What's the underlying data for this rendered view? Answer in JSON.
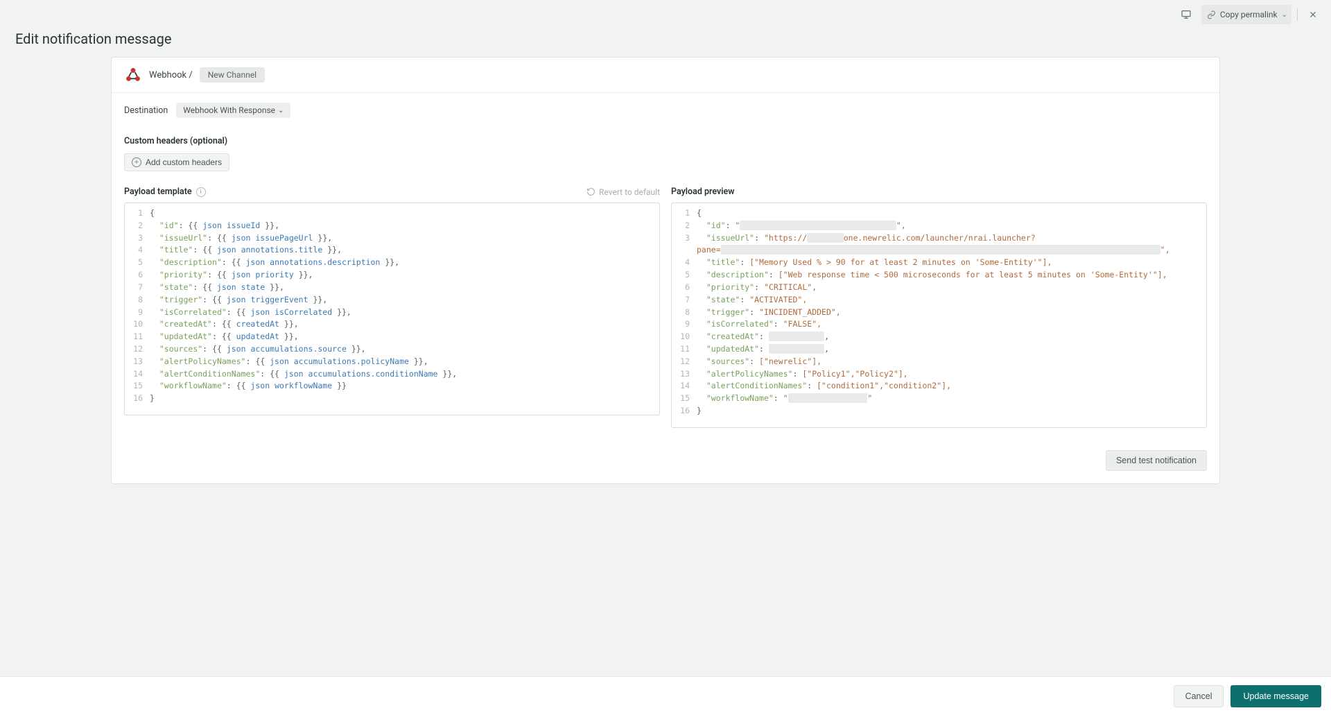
{
  "topbar": {
    "copy_permalink": "Copy permalink"
  },
  "page": {
    "title": "Edit notification message"
  },
  "header": {
    "breadcrumb": "Webhook /",
    "channel_chip": "New Channel"
  },
  "destination": {
    "label": "Destination",
    "value": "Webhook With Response"
  },
  "custom_headers": {
    "label": "Custom headers (optional)",
    "button": "Add custom headers"
  },
  "template": {
    "title": "Payload template",
    "revert": "Revert to default",
    "lines": [
      {
        "n": 1,
        "segs": [
          [
            "{",
            "pun"
          ]
        ]
      },
      {
        "n": 2,
        "segs": [
          [
            "  ",
            ""
          ],
          [
            "\"id\"",
            "prop"
          ],
          [
            ": {{ ",
            "pun"
          ],
          [
            "json",
            "kw"
          ],
          [
            " ",
            "pun"
          ],
          [
            "issueId",
            "kw"
          ],
          [
            " }},",
            "pun"
          ]
        ]
      },
      {
        "n": 3,
        "segs": [
          [
            "  ",
            ""
          ],
          [
            "\"issueUrl\"",
            "prop"
          ],
          [
            ": {{ ",
            "pun"
          ],
          [
            "json",
            "kw"
          ],
          [
            " ",
            "pun"
          ],
          [
            "issuePageUrl",
            "kw"
          ],
          [
            " }},",
            "pun"
          ]
        ]
      },
      {
        "n": 4,
        "segs": [
          [
            "  ",
            ""
          ],
          [
            "\"title\"",
            "prop"
          ],
          [
            ": {{ ",
            "pun"
          ],
          [
            "json",
            "kw"
          ],
          [
            " ",
            "pun"
          ],
          [
            "annotations.title",
            "kw"
          ],
          [
            " }},",
            "pun"
          ]
        ]
      },
      {
        "n": 5,
        "segs": [
          [
            "  ",
            ""
          ],
          [
            "\"description\"",
            "prop"
          ],
          [
            ": {{ ",
            "pun"
          ],
          [
            "json",
            "kw"
          ],
          [
            " ",
            "pun"
          ],
          [
            "annotations.description",
            "kw"
          ],
          [
            " }},",
            "pun"
          ]
        ]
      },
      {
        "n": 6,
        "segs": [
          [
            "  ",
            ""
          ],
          [
            "\"priority\"",
            "prop"
          ],
          [
            ": {{ ",
            "pun"
          ],
          [
            "json",
            "kw"
          ],
          [
            " ",
            "pun"
          ],
          [
            "priority",
            "kw"
          ],
          [
            " }},",
            "pun"
          ]
        ]
      },
      {
        "n": 7,
        "segs": [
          [
            "  ",
            ""
          ],
          [
            "\"state\"",
            "prop"
          ],
          [
            ": {{ ",
            "pun"
          ],
          [
            "json",
            "kw"
          ],
          [
            " ",
            "pun"
          ],
          [
            "state",
            "kw"
          ],
          [
            " }},",
            "pun"
          ]
        ]
      },
      {
        "n": 8,
        "segs": [
          [
            "  ",
            ""
          ],
          [
            "\"trigger\"",
            "prop"
          ],
          [
            ": {{ ",
            "pun"
          ],
          [
            "json",
            "kw"
          ],
          [
            " ",
            "pun"
          ],
          [
            "triggerEvent",
            "kw"
          ],
          [
            " }},",
            "pun"
          ]
        ]
      },
      {
        "n": 9,
        "segs": [
          [
            "  ",
            ""
          ],
          [
            "\"isCorrelated\"",
            "prop"
          ],
          [
            ": {{ ",
            "pun"
          ],
          [
            "json",
            "kw"
          ],
          [
            " ",
            "pun"
          ],
          [
            "isCorrelated",
            "kw"
          ],
          [
            " }},",
            "pun"
          ]
        ]
      },
      {
        "n": 10,
        "segs": [
          [
            "  ",
            ""
          ],
          [
            "\"createdAt\"",
            "prop"
          ],
          [
            ": {{ ",
            "pun"
          ],
          [
            "createdAt",
            "kw"
          ],
          [
            " }},",
            "pun"
          ]
        ]
      },
      {
        "n": 11,
        "segs": [
          [
            "  ",
            ""
          ],
          [
            "\"updatedAt\"",
            "prop"
          ],
          [
            ": {{ ",
            "pun"
          ],
          [
            "updatedAt",
            "kw"
          ],
          [
            " }},",
            "pun"
          ]
        ]
      },
      {
        "n": 12,
        "segs": [
          [
            "  ",
            ""
          ],
          [
            "\"sources\"",
            "prop"
          ],
          [
            ": {{ ",
            "pun"
          ],
          [
            "json",
            "kw"
          ],
          [
            " ",
            "pun"
          ],
          [
            "accumulations.source",
            "kw"
          ],
          [
            " }},",
            "pun"
          ]
        ]
      },
      {
        "n": 13,
        "segs": [
          [
            "  ",
            ""
          ],
          [
            "\"alertPolicyNames\"",
            "prop"
          ],
          [
            ": {{ ",
            "pun"
          ],
          [
            "json",
            "kw"
          ],
          [
            " ",
            "pun"
          ],
          [
            "accumulations.policyName",
            "kw"
          ],
          [
            " }},",
            "pun"
          ]
        ]
      },
      {
        "n": 14,
        "segs": [
          [
            "  ",
            ""
          ],
          [
            "\"alertConditionNames\"",
            "prop"
          ],
          [
            ": {{ ",
            "pun"
          ],
          [
            "json",
            "kw"
          ],
          [
            " ",
            "pun"
          ],
          [
            "accumulations.conditionName",
            "kw"
          ],
          [
            " }},",
            "pun"
          ]
        ]
      },
      {
        "n": 15,
        "segs": [
          [
            "  ",
            ""
          ],
          [
            "\"workflowName\"",
            "prop"
          ],
          [
            ": {{ ",
            "pun"
          ],
          [
            "json",
            "kw"
          ],
          [
            " ",
            "pun"
          ],
          [
            "workflowName",
            "kw"
          ],
          [
            " }}",
            "pun"
          ]
        ]
      },
      {
        "n": 16,
        "segs": [
          [
            "}",
            "pun"
          ]
        ]
      }
    ]
  },
  "preview": {
    "title": "Payload preview",
    "lines": [
      {
        "n": 1,
        "segs": [
          [
            "{",
            "pun"
          ]
        ]
      },
      {
        "n": 2,
        "segs": [
          [
            "  ",
            ""
          ],
          [
            "\"id\"",
            "prop"
          ],
          [
            ": ",
            "pun"
          ],
          [
            "\"",
            "str"
          ],
          [
            "████████████████████████████████",
            "redact"
          ],
          [
            "\",",
            "str"
          ]
        ]
      },
      {
        "n": 3,
        "segs": [
          [
            "  ",
            ""
          ],
          [
            "\"issueUrl\"",
            "prop"
          ],
          [
            ": ",
            "pun"
          ],
          [
            "\"https://",
            "str"
          ],
          [
            "███████",
            "redact"
          ],
          [
            "one.newrelic.com/launcher/nrai.launcher?pane=",
            "str"
          ],
          [
            "███████████████████████████████████████████████████████████████████████████████████████████",
            "redact"
          ],
          [
            "\",",
            "str"
          ]
        ]
      },
      {
        "n": 4,
        "segs": [
          [
            "  ",
            ""
          ],
          [
            "\"title\"",
            "prop"
          ],
          [
            ": ",
            "pun"
          ],
          [
            "[\"Memory Used % > 90 for at least 2 minutes on 'Some-Entity'\"],",
            "str"
          ]
        ]
      },
      {
        "n": 5,
        "segs": [
          [
            "  ",
            ""
          ],
          [
            "\"description\"",
            "prop"
          ],
          [
            ": ",
            "pun"
          ],
          [
            "[\"Web response time < 500 microseconds for at least 5 minutes on 'Some-Entity'\"],",
            "str"
          ]
        ]
      },
      {
        "n": 6,
        "segs": [
          [
            "  ",
            ""
          ],
          [
            "\"priority\"",
            "prop"
          ],
          [
            ": ",
            "pun"
          ],
          [
            "\"CRITICAL\",",
            "str"
          ]
        ]
      },
      {
        "n": 7,
        "segs": [
          [
            "  ",
            ""
          ],
          [
            "\"state\"",
            "prop"
          ],
          [
            ": ",
            "pun"
          ],
          [
            "\"ACTIVATED\",",
            "str"
          ]
        ]
      },
      {
        "n": 8,
        "segs": [
          [
            "  ",
            ""
          ],
          [
            "\"trigger\"",
            "prop"
          ],
          [
            ": ",
            "pun"
          ],
          [
            "\"INCIDENT_ADDED\",",
            "str"
          ]
        ]
      },
      {
        "n": 9,
        "segs": [
          [
            "  ",
            ""
          ],
          [
            "\"isCorrelated\"",
            "prop"
          ],
          [
            ": ",
            "pun"
          ],
          [
            "\"FALSE\",",
            "str"
          ]
        ]
      },
      {
        "n": 10,
        "segs": [
          [
            "  ",
            ""
          ],
          [
            "\"createdAt\"",
            "prop"
          ],
          [
            ": ",
            "pun"
          ],
          [
            "███████████",
            "redact"
          ],
          [
            ",",
            "pun"
          ]
        ]
      },
      {
        "n": 11,
        "segs": [
          [
            "  ",
            ""
          ],
          [
            "\"updatedAt\"",
            "prop"
          ],
          [
            ": ",
            "pun"
          ],
          [
            "███████████",
            "redact"
          ],
          [
            ",",
            "pun"
          ]
        ]
      },
      {
        "n": 12,
        "segs": [
          [
            "  ",
            ""
          ],
          [
            "\"sources\"",
            "prop"
          ],
          [
            ": ",
            "pun"
          ],
          [
            "[\"newrelic\"],",
            "str"
          ]
        ]
      },
      {
        "n": 13,
        "segs": [
          [
            "  ",
            ""
          ],
          [
            "\"alertPolicyNames\"",
            "prop"
          ],
          [
            ": ",
            "pun"
          ],
          [
            "[\"Policy1\",\"Policy2\"],",
            "str"
          ]
        ]
      },
      {
        "n": 14,
        "segs": [
          [
            "  ",
            ""
          ],
          [
            "\"alertConditionNames\"",
            "prop"
          ],
          [
            ": ",
            "pun"
          ],
          [
            "[\"condition1\",\"condition2\"],",
            "str"
          ]
        ]
      },
      {
        "n": 15,
        "segs": [
          [
            "  ",
            ""
          ],
          [
            "\"workflowName\"",
            "prop"
          ],
          [
            ": ",
            "pun"
          ],
          [
            "\"",
            "str"
          ],
          [
            "████████████████",
            "redact"
          ],
          [
            "\"",
            "str"
          ]
        ]
      },
      {
        "n": 16,
        "segs": [
          [
            "}",
            "pun"
          ]
        ]
      }
    ]
  },
  "buttons": {
    "send_test": "Send test notification",
    "cancel": "Cancel",
    "update": "Update message"
  }
}
